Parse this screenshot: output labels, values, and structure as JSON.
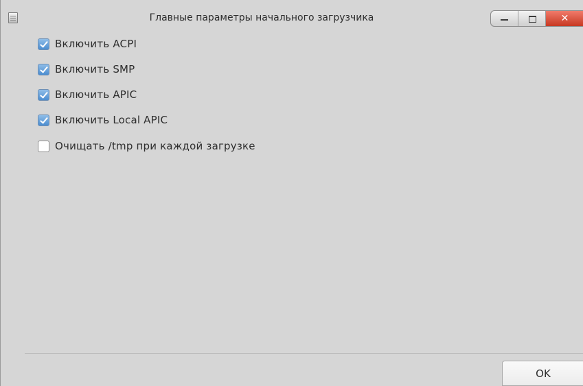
{
  "window": {
    "title": "Главные параметры начального загрузчика",
    "icon": "document-icon",
    "controls": {
      "minimize_icon": "minimize-icon",
      "maximize_icon": "maximize-icon",
      "close_label": "✕",
      "close_color": "#d9452f"
    }
  },
  "options": [
    {
      "label": "Включить ACPI",
      "checked": true
    },
    {
      "label": "Включить SMP",
      "checked": true
    },
    {
      "label": "Включить APIC",
      "checked": true
    },
    {
      "label": "Включить Local APIC",
      "checked": true
    },
    {
      "label": "Очищать /tmp при каждой загрузке",
      "checked": false
    }
  ],
  "footer": {
    "ok_label": "OK"
  },
  "colors": {
    "background": "#d6d6d6",
    "checkbox_accent": "#4c8dd0"
  }
}
